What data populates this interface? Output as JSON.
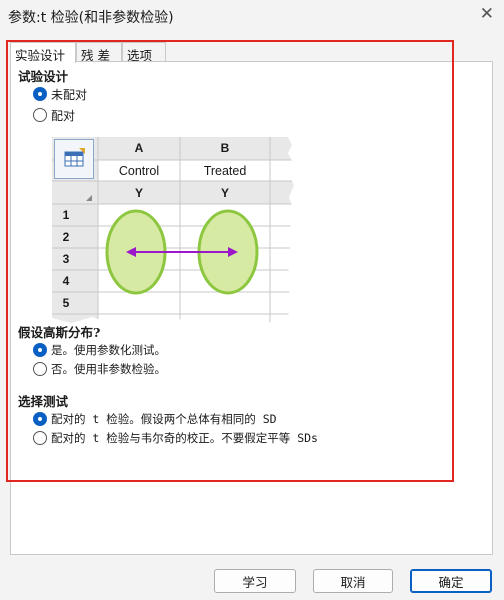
{
  "window": {
    "title": "参数:t 检验(和非参数检验)",
    "close_glyph": "✕"
  },
  "tabs": [
    {
      "label": "实验设计",
      "active": true
    },
    {
      "label": "残差",
      "active": false
    },
    {
      "label": "选项",
      "active": false
    }
  ],
  "design": {
    "heading": "试验设计",
    "options": [
      {
        "label": "未配对",
        "selected": true
      },
      {
        "label": "配对",
        "selected": false
      }
    ]
  },
  "illustration": {
    "columns": [
      "A",
      "B"
    ],
    "column_titles": [
      "Control",
      "Treated"
    ],
    "subheaders": [
      "Y",
      "Y"
    ],
    "rows": [
      "1",
      "2",
      "3",
      "4",
      "5"
    ],
    "table_icon": "table-icon",
    "colors": {
      "ellipse_fill": "#d6eaa3",
      "ellipse_stroke": "#8dc63f",
      "arrow": "#9b17c9",
      "header_fill": "#e8e8e8"
    }
  },
  "normality": {
    "heading": "假设高斯分布?",
    "options": [
      {
        "label": "是。使用参数化测试。",
        "selected": true
      },
      {
        "label": "否。使用非参数检验。",
        "selected": false
      }
    ]
  },
  "test": {
    "heading": "选择测试",
    "options": [
      {
        "label": "配对的 t 检验。假设两个总体有相同的 SD",
        "selected": true
      },
      {
        "label": "配对的 t 检验与韦尔奇的校正。不要假定平等 SDs",
        "selected": false
      }
    ]
  },
  "buttons": {
    "learn": "学习",
    "cancel": "取消",
    "ok": "确定"
  },
  "colors": {
    "accent": "#0a5fc2",
    "highlight_box": "#e0261f"
  }
}
